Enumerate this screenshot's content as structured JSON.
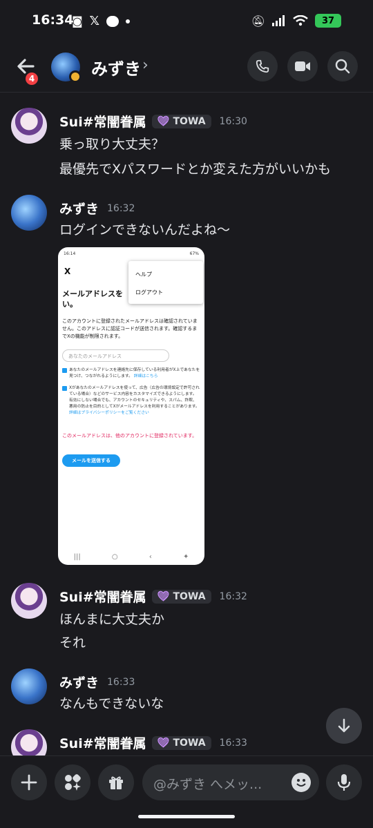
{
  "status_bar": {
    "time": "16:34",
    "battery": "37"
  },
  "header": {
    "back_badge": "4",
    "contact_name": "みずき"
  },
  "messages": [
    {
      "author": "Sui#常闇眷属",
      "tag": "TOWA",
      "time": "16:30",
      "lines": [
        "乗っ取り大丈夫？",
        "最優先でXパスワードとか変えた方がいいかも"
      ]
    },
    {
      "author": "みずき",
      "time": "16:32",
      "lines": [
        "ログインできないんだよね〜"
      ]
    },
    {
      "author": "Sui#常闇眷属",
      "tag": "TOWA",
      "time": "16:32",
      "lines": [
        "ほんまに大丈夫か",
        "それ"
      ]
    },
    {
      "author": "みずき",
      "time": "16:33",
      "lines": [
        "なんもできないな"
      ]
    },
    {
      "author": "Sui#常闇眷属",
      "tag": "TOWA",
      "time": "16:33",
      "lines": []
    }
  ],
  "attachment": {
    "status_time": "16:14",
    "status_right": "67%",
    "x_label": "X",
    "menu": [
      "ヘルプ",
      "ログアウト"
    ],
    "title": "メールアドレスを　　　　い。",
    "body": "このアカウントに登録されたメールアドレスは確認されていません。このアドレスに認証コードが送信されます。確認するまでXの機能が制限されます。",
    "placeholder": "あなたのメールアドレス",
    "check1": "あなたのメールアドレスを連絡先に保存している利用者がX上であなたを見つけ、つながれるようにします。",
    "check1_link": "詳細はこちら",
    "check2": "Xがあなたのメールアドレスを使って、広告（広告の環境設定で許可されている場合）などのサービス内容をカスタマイズできるようにします。有効にしない場合でも、アカウントのセキュリティや、スパム、詐欺、悪用の防止を目的としてXがメールアドレスを利用することがあります。",
    "check2_link": "詳細はプライバシーポリシーをご覧ください",
    "error": "このメールアドレスは、他のアカウントに登録されています。",
    "button": "メールを送信する"
  },
  "composer": {
    "placeholder": "@みずき へメッ..."
  },
  "icons": {
    "back": "arrow-left-icon",
    "call": "phone-icon",
    "video": "video-icon",
    "search": "search-icon",
    "scroll_down": "arrow-down-icon",
    "add": "plus-icon",
    "apps": "apps-icon",
    "gift": "gift-icon",
    "emoji": "emoji-icon",
    "mic": "mic-icon"
  }
}
